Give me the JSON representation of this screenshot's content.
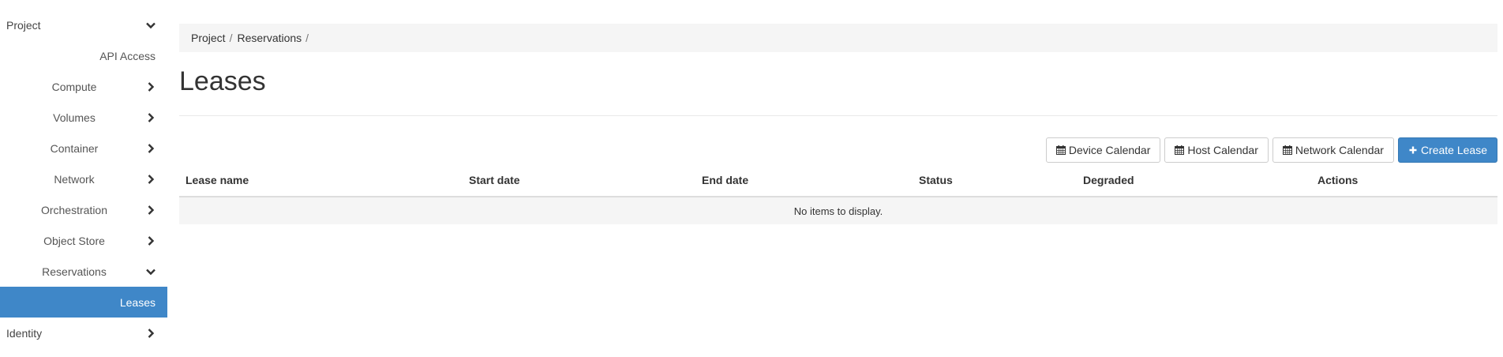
{
  "sidebar": {
    "items": [
      {
        "label": "Project",
        "chevron": "chevron-down-icon"
      },
      {
        "label": "API Access"
      },
      {
        "label": "Compute",
        "chevron": "chevron-right-icon"
      },
      {
        "label": "Volumes",
        "chevron": "chevron-right-icon"
      },
      {
        "label": "Container",
        "chevron": "chevron-right-icon"
      },
      {
        "label": "Network",
        "chevron": "chevron-right-icon"
      },
      {
        "label": "Orchestration",
        "chevron": "chevron-right-icon"
      },
      {
        "label": "Object Store",
        "chevron": "chevron-right-icon"
      },
      {
        "label": "Reservations",
        "chevron": "chevron-down-icon"
      },
      {
        "label": "Leases",
        "active": true
      },
      {
        "label": "Identity",
        "chevron": "chevron-right-icon"
      }
    ]
  },
  "breadcrumb": {
    "items": [
      "Project",
      "Reservations"
    ],
    "separator": "/"
  },
  "page": {
    "title": "Leases"
  },
  "toolbar": {
    "device_calendar": "Device Calendar",
    "host_calendar": "Host Calendar",
    "network_calendar": "Network Calendar",
    "create_lease": "Create Lease",
    "calendar_icon": "calendar-icon",
    "plus_icon": "plus-icon"
  },
  "table": {
    "columns": [
      "Lease name",
      "Start date",
      "End date",
      "Status",
      "Degraded",
      "Actions"
    ],
    "empty_message": "No items to display."
  },
  "colors": {
    "accent": "#3f87c8",
    "breadcrumb_bg": "#f5f5f5",
    "text": "#333333"
  }
}
